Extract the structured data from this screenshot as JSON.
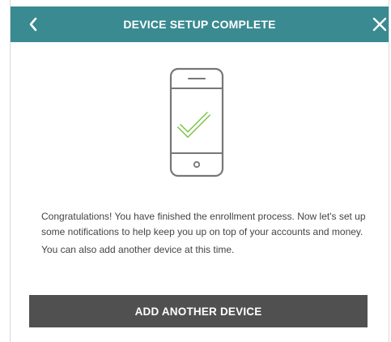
{
  "header": {
    "title": "DEVICE SETUP COMPLETE",
    "back_icon": "chevron-left-icon",
    "close_icon": "close-icon"
  },
  "illustration": {
    "icon": "phone-checkmark-icon"
  },
  "message": {
    "paragraph": "Congratulations! You have finished the enrollment process. Now let's set up some notifications to help keep you up on top of your accounts and money.",
    "secondary": "You can also add another device at this time."
  },
  "actions": {
    "add_device_label": "ADD ANOTHER DEVICE"
  },
  "colors": {
    "header_bg": "#3a8a91",
    "button_bg": "#505050",
    "check_green": "#7ac143",
    "phone_outline": "#777777"
  }
}
